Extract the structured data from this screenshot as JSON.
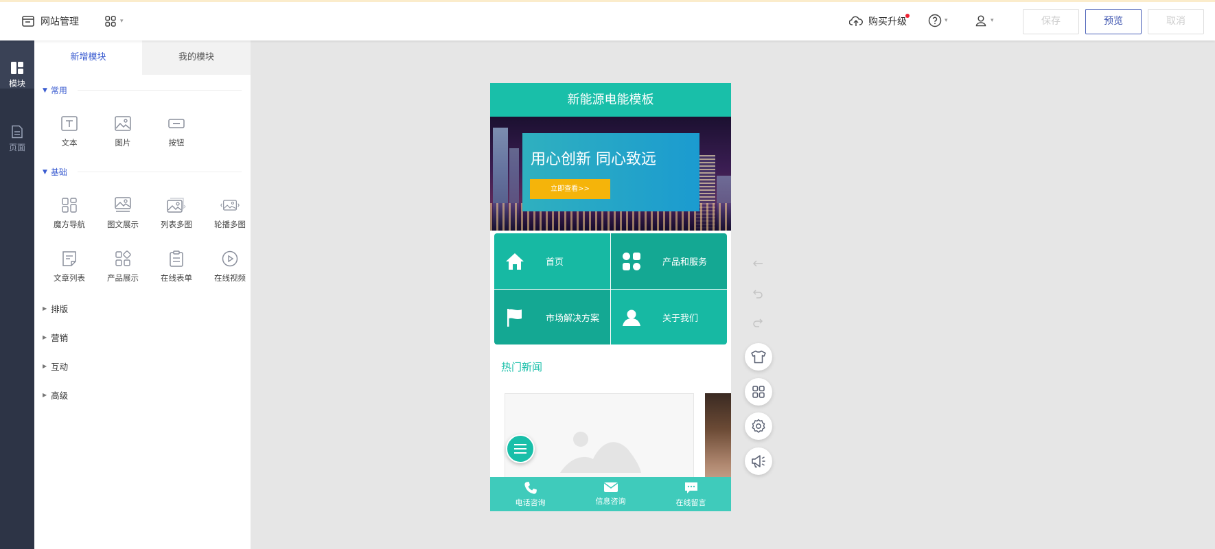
{
  "topbar": {
    "site_manage": "网站管理",
    "buy_upgrade": "购买升级",
    "save": "保存",
    "preview": "预览",
    "cancel": "取消"
  },
  "rail": {
    "items": [
      {
        "label": "模块",
        "icon": "modules-icon",
        "active": true
      },
      {
        "label": "页面",
        "icon": "page-icon",
        "active": false
      }
    ]
  },
  "panel": {
    "tabs": [
      "新增模块",
      "我的模块"
    ],
    "active_tab": "新增模块",
    "sections": [
      {
        "name": "常用",
        "expanded": true,
        "tools": [
          {
            "label": "文本",
            "icon": "text-icon"
          },
          {
            "label": "图片",
            "icon": "image-icon"
          },
          {
            "label": "按钮",
            "icon": "button-icon"
          }
        ]
      },
      {
        "name": "基础",
        "expanded": true,
        "tools": [
          {
            "label": "魔方导航",
            "icon": "cube-nav-icon"
          },
          {
            "label": "图文展示",
            "icon": "image-text-icon"
          },
          {
            "label": "列表多图",
            "icon": "list-images-icon"
          },
          {
            "label": "轮播多图",
            "icon": "carousel-icon"
          },
          {
            "label": "文章列表",
            "icon": "article-list-icon"
          },
          {
            "label": "产品展示",
            "icon": "product-icon"
          },
          {
            "label": "在线表单",
            "icon": "form-icon"
          },
          {
            "label": "在线视频",
            "icon": "video-icon"
          }
        ]
      },
      {
        "name": "排版",
        "expanded": false
      },
      {
        "name": "营销",
        "expanded": false
      },
      {
        "name": "互动",
        "expanded": false
      },
      {
        "name": "高级",
        "expanded": false
      }
    ]
  },
  "phone": {
    "header_title": "新能源电能模板",
    "banner": {
      "title": "用心创新 同心致远",
      "button": "立即查看>>"
    },
    "nav": [
      {
        "label": "首页",
        "icon": "home-icon"
      },
      {
        "label": "产品和服务",
        "icon": "apps-icon"
      },
      {
        "label": "市场解决方案",
        "icon": "flag-icon"
      },
      {
        "label": "关于我们",
        "icon": "person-icon"
      }
    ],
    "hot_news": "热门新闻",
    "bottom_bar": [
      {
        "label": "电话咨询",
        "icon": "phone-icon"
      },
      {
        "label": "信息咨询",
        "icon": "mail-icon"
      },
      {
        "label": "在线留言",
        "icon": "message-icon"
      }
    ]
  },
  "colors": {
    "accent": "#19bfa9",
    "primary_blue": "#3b5cd0",
    "rail_bg": "#2d3446",
    "banner_button": "#f5b40a"
  }
}
